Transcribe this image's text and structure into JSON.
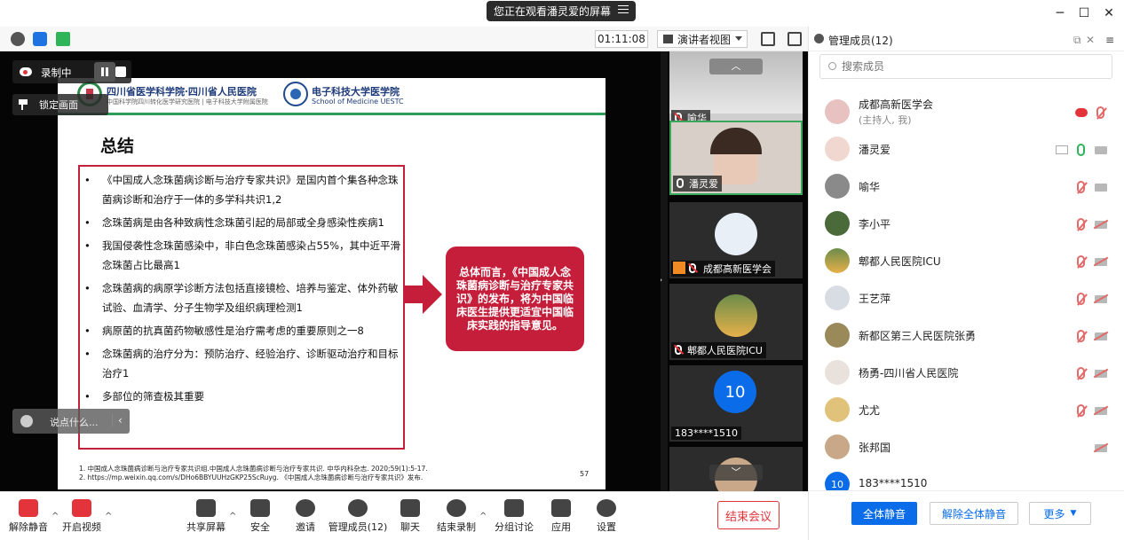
{
  "window": {
    "share_notice": "您正在观看潘灵爱的屏幕",
    "timer": "01:11:08",
    "view_mode": "演讲者视图"
  },
  "stage": {
    "recording_label": "录制中",
    "pin_label": "锁定画面",
    "chat_placeholder": "说点什么..."
  },
  "slide": {
    "header_left": "四川省医学科学院·四川省人民医院",
    "header_left_sub": "中国科学院四川转化医学研究医院 | 电子科技大学附属医院",
    "header_right": "电子科技大学医学院",
    "header_right_sub": "School of Medicine UESTC",
    "title": "总结",
    "bullets": [
      "《中国成人念珠菌病诊断与治疗专家共识》是国内首个集各种念珠菌病诊断和治疗于一体的多学科共识1,2",
      "念珠菌病是由各种致病性念珠菌引起的局部或全身感染性疾病1",
      "我国侵袭性念珠菌感染中，非白色念珠菌感染占55%，其中近平滑念珠菌占比最高1",
      "念珠菌病的病原学诊断方法包括直接镜检、培养与鉴定、体外药敏试验、血清学、分子生物学及组织病理检测1",
      "病原菌的抗真菌药物敏感性是治疗需考虑的重要原则之一8",
      "念珠菌病的治疗分为：预防治疗、经验治疗、诊断驱动治疗和目标治疗1",
      "多部位的筛查极其重要"
    ],
    "callout": "总体而言，《中国成人念珠菌病诊断与治疗专家共识》的发布，将为中国临床医生提供更适宜中国临床实践的指导意见。",
    "footnote_1": "1. 中国成人念珠菌病诊断与治疗专家共识组.中国成人念珠菌病诊断与治疗专家共识. 中华内科杂志. 2020;59(1):5-17.",
    "footnote_2": "2. https://mp.weixin.qq.com/s/DHo6BBYUUHzGKP25ScRuyg. 《中国成人念珠菌病诊断与治疗专家共识》发布.",
    "page_number": "57"
  },
  "strip": {
    "tiles": [
      {
        "label": "喻华",
        "muted": true
      },
      {
        "label": "潘灵爱",
        "muted": false
      },
      {
        "label": "成都高新医学会",
        "muted": true
      },
      {
        "label": "郫都人民医院ICU",
        "muted": true
      },
      {
        "label": "183****1510",
        "avatar_text": "10"
      },
      {
        "label": ""
      }
    ]
  },
  "panel": {
    "title": "管理成员(12)",
    "search_placeholder": "搜索成员",
    "members": [
      {
        "name": "成都高新医学会",
        "sub": "(主持人, 我)"
      },
      {
        "name": "潘灵爱"
      },
      {
        "name": "喻华"
      },
      {
        "name": "李小平"
      },
      {
        "name": "郫都人民医院ICU"
      },
      {
        "name": "王艺萍"
      },
      {
        "name": "新都区第三人民医院张勇"
      },
      {
        "name": "杨勇-四川省人民医院"
      },
      {
        "name": "尤尤"
      },
      {
        "name": "张邦国"
      },
      {
        "name": "183****1510",
        "avatar_text": "10"
      }
    ],
    "mute_all": "全体静音",
    "unmute_all": "解除全体静音",
    "more": "更多"
  },
  "toolbar": {
    "unmute": "解除静音",
    "start_video": "开启视频",
    "share_screen": "共享屏幕",
    "security": "安全",
    "invite": "邀请",
    "manage_members": "管理成员(12)",
    "chat": "聊天",
    "end_recording": "结束录制",
    "breakout": "分组讨论",
    "apps": "应用",
    "settings": "设置",
    "end_meeting": "结束会议"
  },
  "colors": {
    "accent": "#0a6ce8",
    "danger": "#e3343b",
    "slide_red": "#c41e3a"
  }
}
